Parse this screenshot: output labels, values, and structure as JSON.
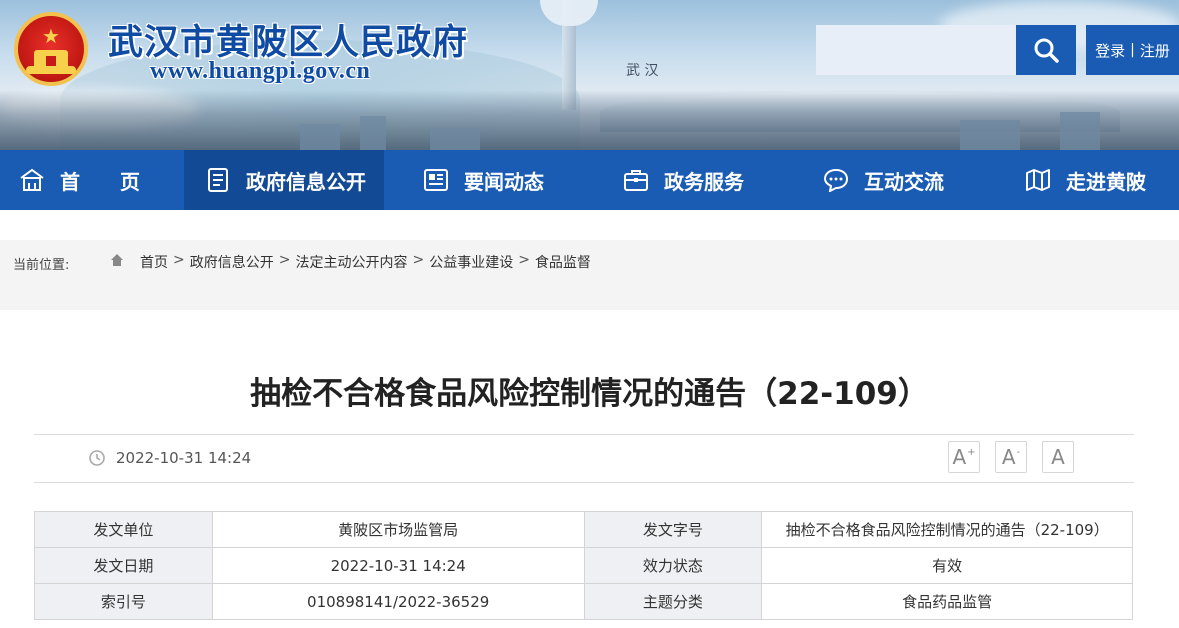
{
  "header": {
    "site_title": "武汉市黄陂区人民政府",
    "site_url": "www.huangpi.gov.cn",
    "search_placeholder": "",
    "login_label": "登录",
    "separator": "|",
    "register_label": "注册",
    "banner_text": "武 汉"
  },
  "nav": {
    "items": [
      {
        "label": "首　　页",
        "icon": "home-icon"
      },
      {
        "label": "政府信息公开",
        "icon": "document-list-icon"
      },
      {
        "label": "要闻动态",
        "icon": "newspaper-icon"
      },
      {
        "label": "政务服务",
        "icon": "briefcase-icon"
      },
      {
        "label": "互动交流",
        "icon": "chat-bubble-icon"
      },
      {
        "label": "走进黄陂",
        "icon": "map-book-icon"
      }
    ],
    "active_index": 1
  },
  "breadcrumb": {
    "label": "当前位置:",
    "items": [
      "首页",
      "政府信息公开",
      "法定主动公开内容",
      "公益事业建设",
      "食品监督"
    ],
    "separator": ">"
  },
  "article": {
    "title": "抽检不合格食品风险控制情况的通告（22-109）",
    "date": "2022-10-31 14:24",
    "font_controls": [
      "A",
      "A",
      "A"
    ],
    "font_control_marks": [
      "+",
      "-"
    ]
  },
  "info_table": {
    "rows": [
      [
        "发文单位",
        "黄陂区市场监管局",
        "发文字号",
        "抽检不合格食品风险控制情况的通告（22-109）"
      ],
      [
        "发文日期",
        "2022-10-31 14:24",
        "效力状态",
        "有效"
      ],
      [
        "索引号",
        "010898141/2022-36529",
        "主题分类",
        "食品药品监管"
      ]
    ]
  },
  "colors": {
    "primary_blue": "#1a5bb4",
    "nav_active": "#134a96",
    "title_blue": "#0f4aa3",
    "label_bg": "#eef0f3"
  }
}
